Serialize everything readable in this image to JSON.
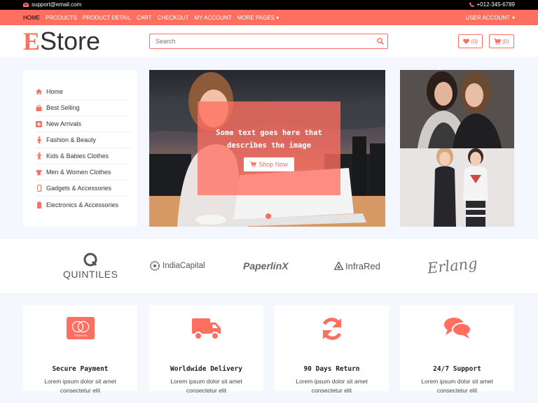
{
  "topbar": {
    "email": "support@email.com",
    "phone": "+012-345-6789"
  },
  "nav": {
    "items": [
      "HOME",
      "PRODUCTS",
      "PRODUCT DETAIL",
      "CART",
      "CHECKOUT",
      "MY ACCOUNT",
      "MORE PAGES"
    ],
    "user_account": "USER ACCOUNT"
  },
  "header": {
    "logo_initial": "E",
    "logo_rest": "Store",
    "search_placeholder": "Search",
    "wishlist_count": "(0)",
    "cart_count": "(0)"
  },
  "sidebar": {
    "items": [
      {
        "label": "Home",
        "icon": "home-icon"
      },
      {
        "label": "Best Selling",
        "icon": "shopping-bag-icon"
      },
      {
        "label": "New Arrivals",
        "icon": "plus-square-icon"
      },
      {
        "label": "Fashion & Beauty",
        "icon": "female-icon"
      },
      {
        "label": "Kids & Babies Clothes",
        "icon": "child-icon"
      },
      {
        "label": "Men & Women Clothes",
        "icon": "tshirt-icon"
      },
      {
        "label": "Gadgets & Accessories",
        "icon": "mobile-icon"
      },
      {
        "label": "Electronics & Accessories",
        "icon": "battery-icon"
      }
    ]
  },
  "hero": {
    "caption": "Some text goes here that describes the image",
    "button_label": "Shop Now"
  },
  "brands": {
    "items": [
      "QUINTILES",
      "IndiaCapital",
      "PaperlinX",
      "InfraRed",
      "Erlang"
    ]
  },
  "features": [
    {
      "title": "Secure Payment",
      "desc": "Lorem ipsum dolor sit amet consectetur elit",
      "icon": "credit-card-icon",
      "card_text": "mastercard"
    },
    {
      "title": "Worldwide Delivery",
      "desc": "Lorem ipsum dolor sit amet consectetur elit",
      "icon": "truck-icon"
    },
    {
      "title": "90 Days Return",
      "desc": "Lorem ipsum dolor sit amet consectetur elit",
      "icon": "sync-icon"
    },
    {
      "title": "24/7 Support",
      "desc": "Lorem ipsum dolor sit amet consectetur elit",
      "icon": "comments-icon"
    }
  ],
  "colors": {
    "accent": "#ff6f61",
    "topbar": "#000000",
    "page_bg": "#f5f7fe"
  }
}
